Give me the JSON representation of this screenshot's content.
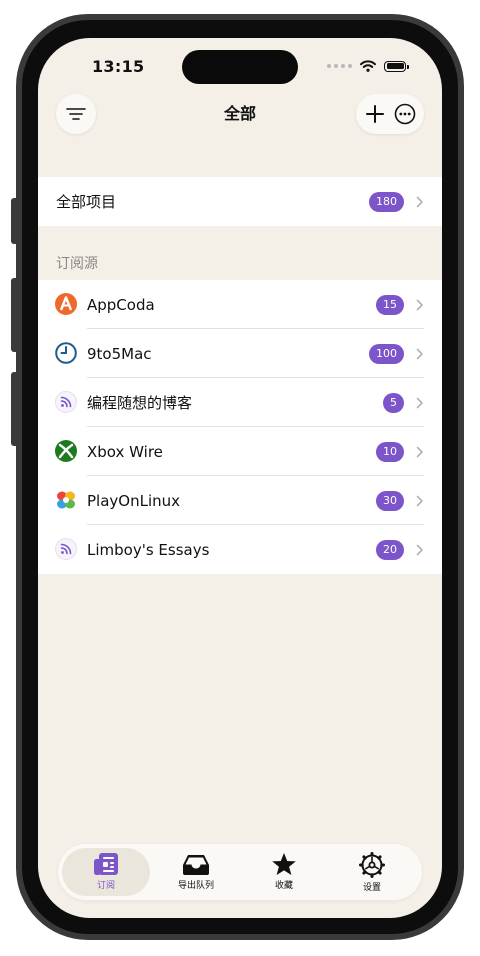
{
  "status_bar": {
    "time": "13:15"
  },
  "nav": {
    "title": "全部"
  },
  "all_items": {
    "label": "全部项目",
    "count": "180"
  },
  "feeds_section": {
    "header": "订阅源",
    "items": [
      {
        "name": "AppCoda",
        "count": "15",
        "icon": "appcoda-icon"
      },
      {
        "name": "9to5Mac",
        "count": "100",
        "icon": "clock-icon"
      },
      {
        "name": "编程随想的博客",
        "count": "5",
        "icon": "rss-icon"
      },
      {
        "name": "Xbox Wire",
        "count": "10",
        "icon": "xbox-icon"
      },
      {
        "name": "PlayOnLinux",
        "count": "30",
        "icon": "playonlinux-icon"
      },
      {
        "name": "Limboy's Essays",
        "count": "20",
        "icon": "rss-icon"
      }
    ]
  },
  "tabbar": {
    "tabs": [
      {
        "label": "订阅",
        "icon": "newspaper-icon",
        "active": true
      },
      {
        "label": "导出队列",
        "icon": "inbox-tray-icon",
        "active": false
      },
      {
        "label": "收藏",
        "icon": "star-icon",
        "active": false
      },
      {
        "label": "设置",
        "icon": "gear-icon",
        "active": false
      }
    ]
  },
  "colors": {
    "accent": "#7b55c9",
    "background": "#f4f0e8",
    "surface": "#ffffff"
  }
}
